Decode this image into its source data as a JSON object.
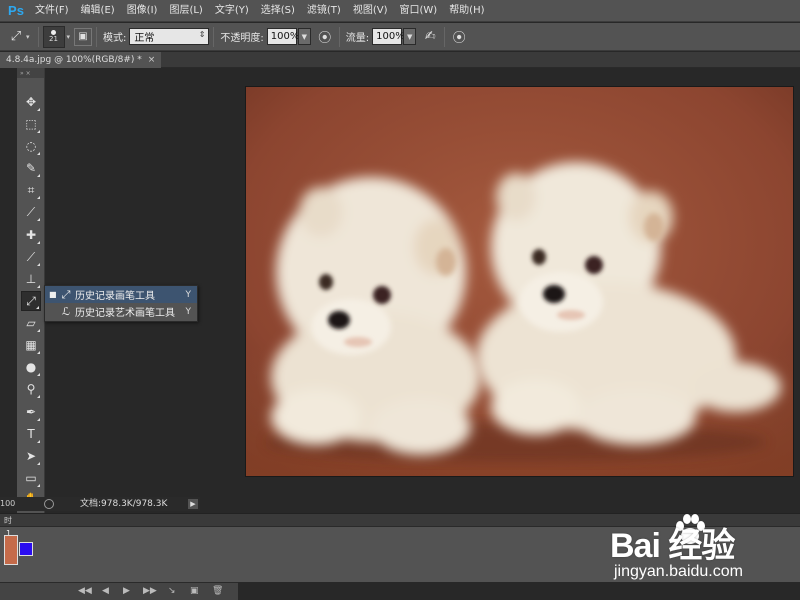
{
  "app": {
    "logo": "Ps"
  },
  "menubar": {
    "items": [
      "文件(F)",
      "编辑(E)",
      "图像(I)",
      "图层(L)",
      "文字(Y)",
      "选择(S)",
      "滤镜(T)",
      "视图(V)",
      "窗口(W)",
      "帮助(H)"
    ]
  },
  "options": {
    "tool_icon": "history-brush-icon",
    "brush_size": "21",
    "mode_label": "模式:",
    "mode_value": "正常",
    "opacity_label": "不透明度:",
    "opacity_value": "100%",
    "flow_label": "流量:",
    "flow_value": "100%"
  },
  "document": {
    "tab_title": "4.8.4a.jpg @ 100%(RGB/8#) *",
    "close": "×",
    "status_zoom": "100",
    "doc_info": "文档:978.3K/978.3K"
  },
  "tools": {
    "panel_toggle": "» ×",
    "items": [
      {
        "name": "move-tool",
        "icon": "move-icon",
        "glyph": "✥"
      },
      {
        "name": "marquee-tool",
        "icon": "marquee-icon",
        "glyph": "⬚"
      },
      {
        "name": "lasso-tool",
        "icon": "lasso-icon",
        "glyph": "◌"
      },
      {
        "name": "quick-select-tool",
        "icon": "quick-select-icon",
        "glyph": "✎"
      },
      {
        "name": "crop-tool",
        "icon": "crop-icon",
        "glyph": "⌗"
      },
      {
        "name": "eyedropper-tool",
        "icon": "eyedropper-icon",
        "glyph": "⟋"
      },
      {
        "name": "healing-brush-tool",
        "icon": "bandage-icon",
        "glyph": "✚"
      },
      {
        "name": "brush-tool",
        "icon": "brush-icon",
        "glyph": "⟋"
      },
      {
        "name": "clone-stamp-tool",
        "icon": "stamp-icon",
        "glyph": "⊥"
      },
      {
        "name": "history-brush-tool",
        "icon": "history-brush-icon",
        "glyph": "⤢"
      },
      {
        "name": "eraser-tool",
        "icon": "eraser-icon",
        "glyph": "▱"
      },
      {
        "name": "gradient-tool",
        "icon": "gradient-icon",
        "glyph": "▦"
      },
      {
        "name": "blur-tool",
        "icon": "blur-drop-icon",
        "glyph": "●"
      },
      {
        "name": "dodge-tool",
        "icon": "dodge-icon",
        "glyph": "⚲"
      },
      {
        "name": "pen-tool",
        "icon": "pen-icon",
        "glyph": "✒"
      },
      {
        "name": "type-tool",
        "icon": "type-icon",
        "glyph": "T"
      },
      {
        "name": "path-select-tool",
        "icon": "arrow-icon",
        "glyph": "➤"
      },
      {
        "name": "shape-tool",
        "icon": "rectangle-icon",
        "glyph": "▭"
      },
      {
        "name": "hand-tool",
        "icon": "hand-icon",
        "glyph": "✋"
      },
      {
        "name": "zoom-tool",
        "icon": "zoom-icon",
        "glyph": "⚲"
      }
    ]
  },
  "flyout": {
    "items": [
      {
        "bullet": "■",
        "label": "历史记录画笔工具",
        "key": "Y",
        "icon": "history-brush-icon"
      },
      {
        "bullet": "",
        "label": "历史记录艺术画笔工具",
        "key": "Y",
        "icon": "art-history-brush-icon"
      }
    ]
  },
  "panels": {
    "tab_label": "时",
    "layer_num": "1"
  },
  "colors": {
    "foreground": "#2a0cf0",
    "background": "#b6d40d",
    "canvas_bg": "#282828",
    "panel_bg": "#535353",
    "accent": "#2da8f0"
  },
  "watermark": {
    "logo": "Bai 经验",
    "url": "jingyan.baidu.com"
  }
}
